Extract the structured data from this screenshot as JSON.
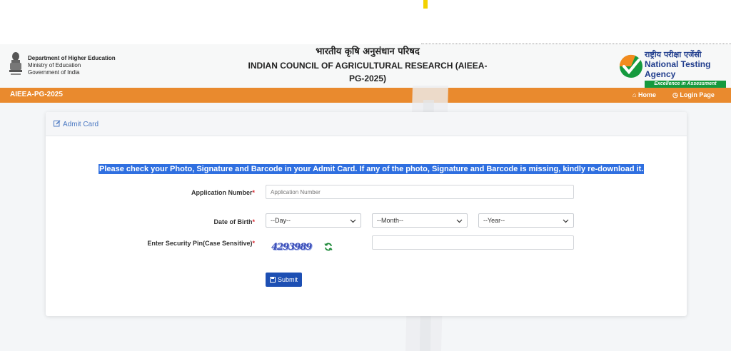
{
  "header": {
    "dept_name": "Department of Higher Education",
    "ministry": "Ministry of Education",
    "government": "Government of India",
    "title_hindi": "भारतीय कृषि अनुसंधान परिषद",
    "title_english_line1": "INDIAN COUNCIL OF AGRICULTURAL RESEARCH (AIEEA-",
    "title_english_line2": "PG-2025)",
    "nta_hindi": "राष्ट्रीय परीक्षा एजेंसी",
    "nta_english": "National Testing Agency",
    "nta_tagline": "Excellence in Assessment"
  },
  "navbar": {
    "brand": "AIEEA-PG-2025",
    "home_label": "Home",
    "login_label": "Login Page",
    "home_icon": "home-icon",
    "login_icon": "clock-icon",
    "bg_color": "#e98a2e"
  },
  "card": {
    "title": "Admit Card",
    "title_icon": "edit-icon",
    "notice": "Please check your Photo, Signature and Barcode in your Admit Card. If any of the photo, Signature and Barcode is missing, kindly re-download it."
  },
  "form": {
    "application_label": "Application Number",
    "application_placeholder": "Application Number",
    "application_value": "",
    "dob_label": "Date of Birth",
    "day_selected": "--Day--",
    "month_selected": "--Month--",
    "year_selected": "--Year--",
    "pin_label": "Enter Security Pin(Case Sensitive)",
    "captcha_text": "4293989",
    "pin_value": "",
    "required_marker": "*",
    "submit_label": "Submit",
    "submit_icon": "save-icon",
    "refresh_icon": "refresh-icon"
  }
}
